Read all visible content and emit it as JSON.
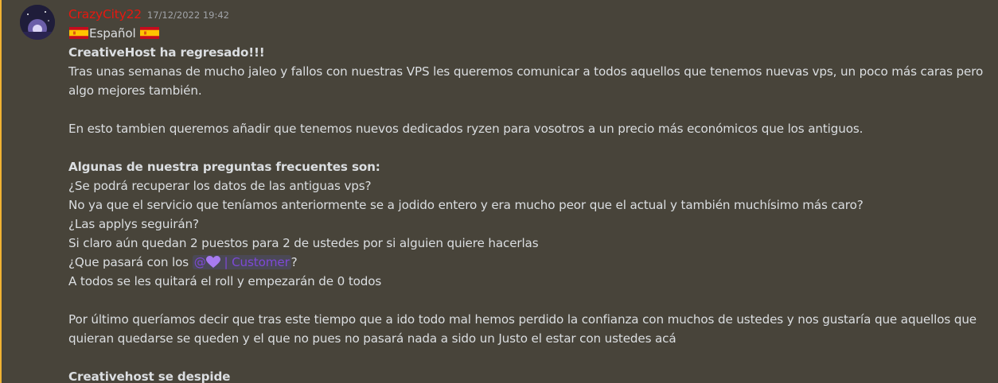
{
  "message": {
    "username": "CrazyCity22",
    "timestamp": "17/12/2022 19:42",
    "language_label": "Español",
    "title": "CreativeHost ha regresado!!!",
    "paragraph1": "Tras unas semanas de mucho jaleo y fallos con nuestras VPS les queremos comunicar a todos aquellos que tenemos nuevas vps, un poco más caras pero algo mejores también.",
    "paragraph2": "En esto tambien queremos añadir que tenemos nuevos dedicados ryzen para vosotros a un precio más económicos que los antiguos.",
    "faq_heading": "Algunas de nuestra preguntas frecuentes son:",
    "faq_q1": "¿Se podrá recuperar los datos de las antiguas vps?",
    "faq_a1": "No ya que el servicio que teníamos anteriormente se a jodido entero y era mucho peor que el actual y también muchísimo más caro?",
    "faq_q2": "¿Las applys seguirán?",
    "faq_a2": "Si claro aún quedan 2 puestos para 2 de ustedes por si alguien quiere hacerlas",
    "faq_q3_prefix": "¿Que pasará con los ",
    "mention_at": "@",
    "mention_role": " | Customer",
    "faq_q3_suffix": "?",
    "faq_a3": "A todos se les quitará el roll y empezarán de 0 todos",
    "closing": "Por último queríamos decir que tras este tiempo que a ido todo mal hemos perdido la confianza con muchos de ustedes y nos gustaría que aquellos que quieran quedarse se queden y el que no pues no pasará nada a sido un Justo el estar con ustedes acá",
    "signoff": "Creativehost se despide"
  },
  "colors": {
    "background": "#48443a",
    "username": "#e8170f",
    "mention_bar": "#f0b232",
    "mention_text": "#7d49d6"
  },
  "icons": {
    "flag": "spain-flag-icon",
    "heart": "purple-heart-icon"
  }
}
